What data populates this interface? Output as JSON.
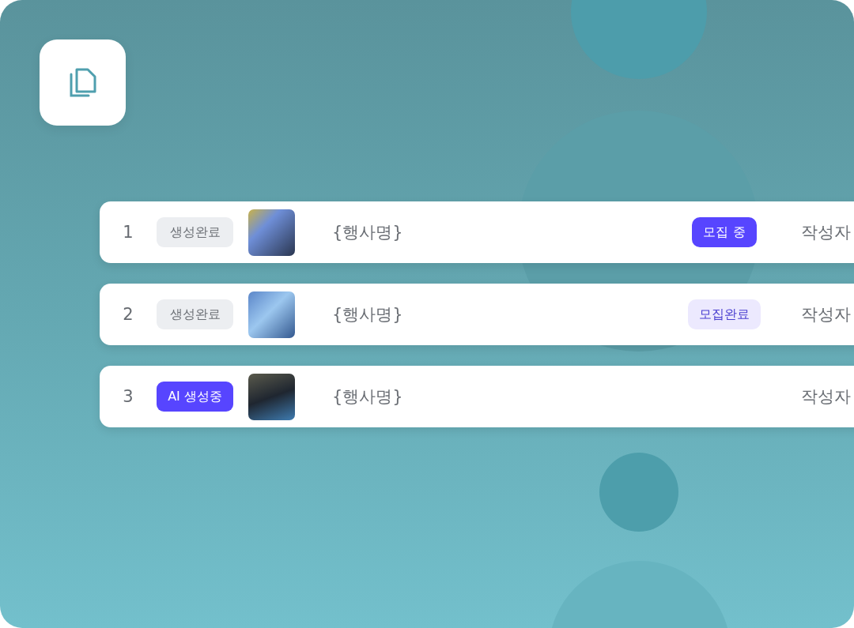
{
  "rows": [
    {
      "number": "1",
      "status": {
        "kind": "done",
        "label": "생성완료"
      },
      "title": "{행사명}",
      "recruit": {
        "kind": "open",
        "label": "모집 중"
      },
      "author": "작성자"
    },
    {
      "number": "2",
      "status": {
        "kind": "done",
        "label": "생성완료"
      },
      "title": "{행사명}",
      "recruit": {
        "kind": "closed",
        "label": "모집완료"
      },
      "author": "작성자"
    },
    {
      "number": "3",
      "status": {
        "kind": "generating",
        "label": "AI 생성중"
      },
      "title": "{행사명}",
      "author": "작성자"
    }
  ]
}
